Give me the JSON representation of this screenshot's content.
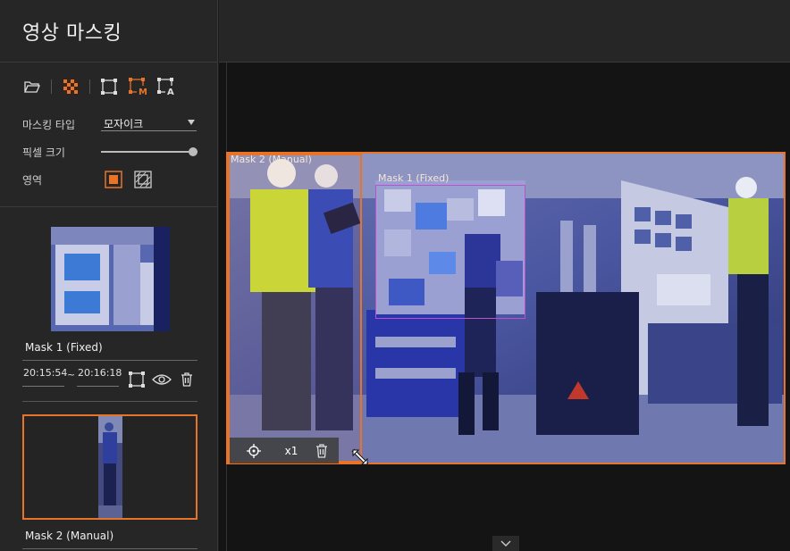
{
  "app": {
    "title": "영상 마스킹"
  },
  "toolbar": {
    "items": [
      {
        "name": "open-folder",
        "icon": "folder-open-icon"
      },
      {
        "name": "mosaic",
        "icon": "mosaic-icon",
        "active": true
      },
      {
        "name": "rect-mask",
        "icon": "rectangle-icon"
      },
      {
        "name": "manual-mask",
        "icon": "rectangle-m-icon",
        "letter": "M"
      },
      {
        "name": "auto-mask",
        "icon": "rectangle-a-icon",
        "letter": "A"
      }
    ]
  },
  "settings": {
    "mask_type_label": "마스킹 타입",
    "mask_type_value": "모자이크",
    "pixel_size_label": "픽셀 크기",
    "pixel_size_value": 1.0,
    "area_label": "영역"
  },
  "masks": [
    {
      "label": "Mask 1 (Fixed)",
      "start": "20:15:54",
      "separator": "~",
      "end": "20:16:18"
    },
    {
      "label": "Mask 2 (Manual)"
    }
  ],
  "canvas": {
    "mask1_label": "Mask 1 (Fixed)",
    "mask2_label": "Mask 2 (Manual)",
    "speed_label": "x1"
  },
  "colors": {
    "accent": "#e8742a",
    "mask1_border": "#c04fd0",
    "background": "#141414",
    "panel": "#262626"
  }
}
